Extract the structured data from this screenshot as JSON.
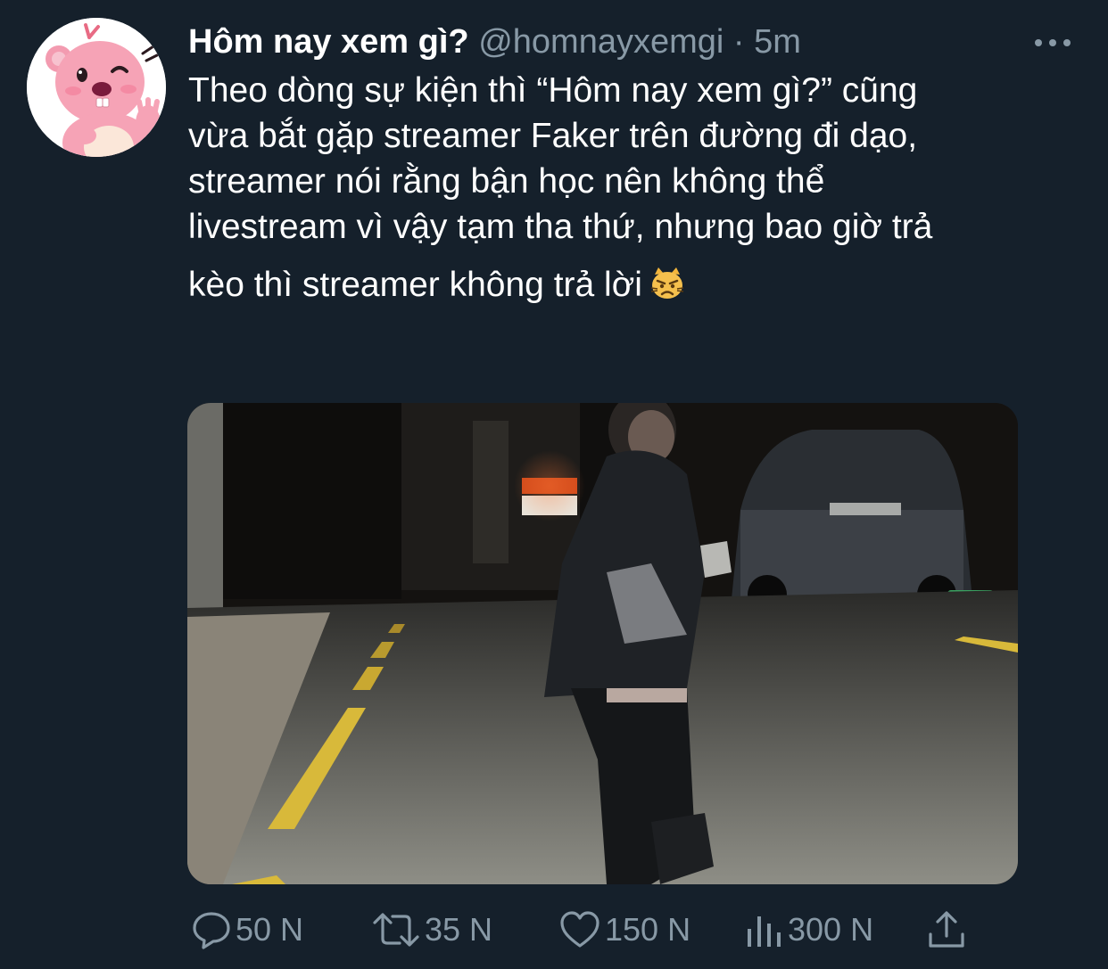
{
  "author": {
    "display_name": "Hôm nay xem gì?",
    "handle": "@homnayxemgi",
    "separator": "·",
    "time": "5m",
    "avatar_icon": "pink-beaver-avatar"
  },
  "tweet": {
    "lines": [
      "Theo dòng sự kiện thì “Hôm nay xem gì?” cũng",
      "vừa bắt gặp streamer Faker trên đường đi dạo,",
      "streamer nói rằng bận học nên không thể",
      "livestream vì vậy tạm tha thứ, nhưng bao giờ trả",
      "kèo thì streamer không trả lời"
    ],
    "emoji": "pouting-cat-icon"
  },
  "media": {
    "type": "video-thumbnail",
    "description_icon": "night-street-photo"
  },
  "actions": {
    "reply": {
      "icon": "reply-icon",
      "count": "50 N"
    },
    "retweet": {
      "icon": "retweet-icon",
      "count": "35 N"
    },
    "like": {
      "icon": "heart-icon",
      "count": "150 N"
    },
    "views": {
      "icon": "analytics-icon",
      "count": "300 N"
    },
    "share": {
      "icon": "share-icon"
    }
  },
  "colors": {
    "background": "#15202b",
    "text": "#ffffff",
    "secondary": "#8899a6"
  }
}
